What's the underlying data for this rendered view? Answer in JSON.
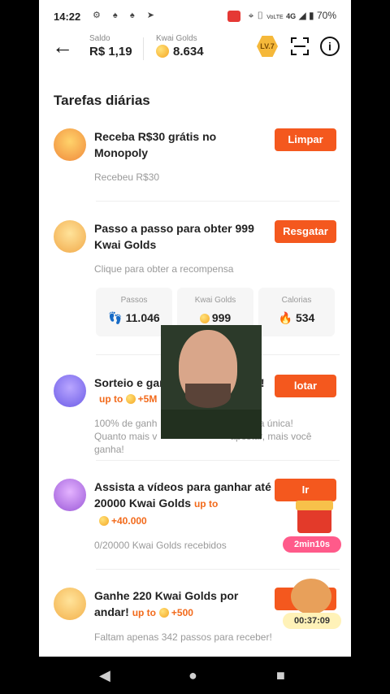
{
  "status": {
    "time": "14:22",
    "signal": "4G",
    "volte": "VoLTE",
    "battery": "70%"
  },
  "header": {
    "saldo_label": "Saldo",
    "saldo_value": "R$ 1,19",
    "golds_label": "Kwai Golds",
    "golds_value": "8.634",
    "level": "LV.7"
  },
  "section_title": "Tarefas diárias",
  "tasks": [
    {
      "title": "Receba R$30 grátis no Monopoly",
      "button": "Limpar",
      "sub": "Recebeu R$30"
    },
    {
      "title": "Passo a passo para obter 999 Kwai Golds",
      "button": "Resgatar",
      "sub": "Clique para obter a recompensa"
    },
    {
      "title": "Sorteio e ganhe",
      "title_tail": "0!",
      "up_to": "up to",
      "reward": "+5M",
      "button": "lotar",
      "sub1": "100% de ganh",
      "sub1_tail": "aposta única!",
      "sub2": "Quanto mais v",
      "sub2_tail": "apostar, mais você ganha!"
    },
    {
      "title": "Assista a vídeos para ganhar até 20000 Kwai Golds",
      "up_to": "up to",
      "reward": "+40.000",
      "button": "Ir",
      "sub": "0/20000 Kwai Golds recebidos"
    },
    {
      "title": "Ganhe 220 Kwai Golds por andar!",
      "up_to": "up to",
      "reward": "+500",
      "button": "L",
      "sub": "Faltam apenas 342 passos para receber!"
    }
  ],
  "stats": [
    {
      "label": "Passos",
      "value": "11.046"
    },
    {
      "label": "Kwai Golds",
      "value": "999"
    },
    {
      "label": "Calorias",
      "value": "534"
    }
  ],
  "timers": {
    "gift": "2min10s",
    "chest": "00:37:09"
  },
  "colors": {
    "accent": "#f4581e",
    "reward": "#f26a1b"
  }
}
